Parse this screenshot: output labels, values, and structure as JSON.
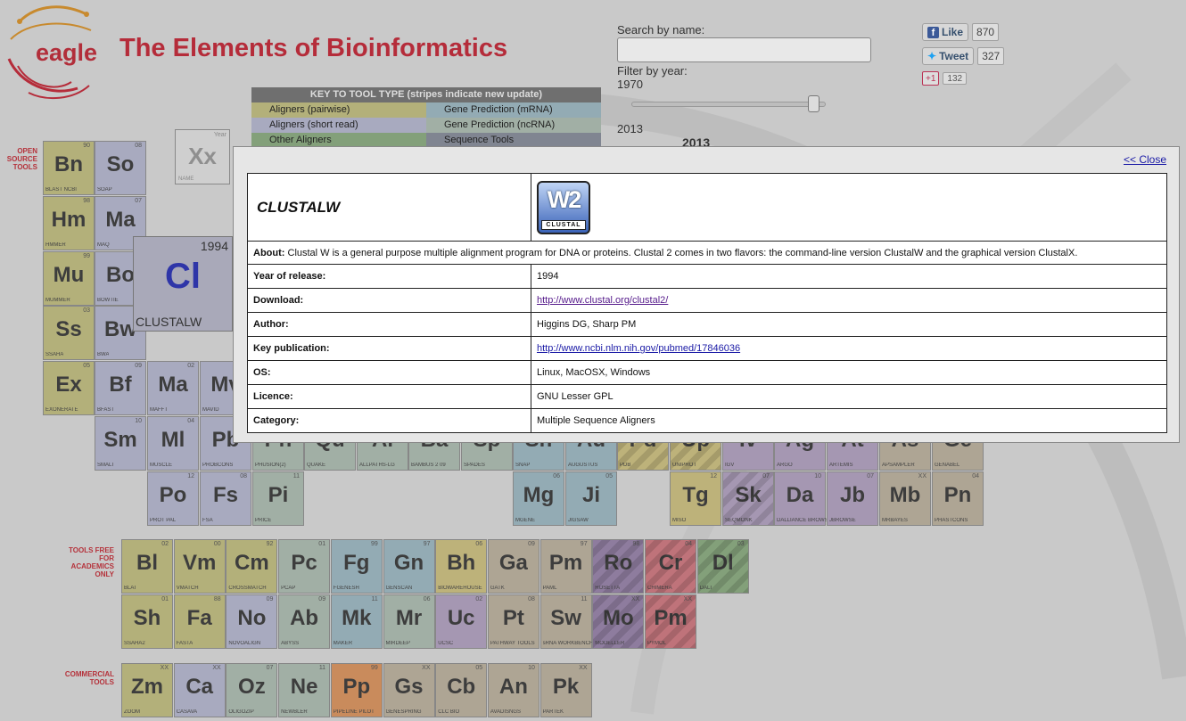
{
  "header": {
    "title": "The Elements of Bioinformatics",
    "logo_text": "eagle"
  },
  "search": {
    "label": "Search by name:",
    "value": "",
    "placeholder": ""
  },
  "filter": {
    "label": "Filter by year:",
    "min_year": "1970",
    "max_year": "2013",
    "slider_position": 0.96,
    "current_year": "2013"
  },
  "social": {
    "like_label": "Like",
    "like_count": "870",
    "tweet_label": "Tweet",
    "tweet_count": "327",
    "plusone_label": "+1",
    "plusone_count": "132"
  },
  "key": {
    "title": "KEY TO TOOL TYPE (stripes indicate new update)",
    "items": [
      {
        "label": "Aligners (pairwise)",
        "color": "#b3b07a"
      },
      {
        "label": "Gene Prediction (mRNA)",
        "color": "#93abb4"
      },
      {
        "label": "Aligners (short read)",
        "color": "#a8aabf"
      },
      {
        "label": "Gene Prediction (ncRNA)",
        "color": "#a1afa5"
      },
      {
        "label": "Other Aligners",
        "color": "#83a07a"
      },
      {
        "label": "Sequence Tools",
        "color": "#808591"
      }
    ]
  },
  "sections": {
    "open_source": "OPEN SOURCE TOOLS",
    "academic": "TOOLS FREE FOR ACADEMICS ONLY",
    "commercial": "COMMERCIAL TOOLS"
  },
  "example_tile": {
    "symbol": "Xx",
    "year": "Year",
    "name": "NAME"
  },
  "hover_tile": {
    "symbol": "Cl",
    "year": "1994",
    "name": "CLUSTALW"
  },
  "tiles": {
    "open": [
      {
        "sym": "Bn",
        "yr": "90",
        "nm": "BLAST NCBI",
        "c": "olive"
      },
      {
        "sym": "So",
        "yr": "08",
        "nm": "SOAP",
        "c": "lavb"
      },
      {
        "sym": "Hm",
        "yr": "98",
        "nm": "HMMER",
        "c": "olive"
      },
      {
        "sym": "Ma",
        "yr": "07",
        "nm": "MAQ",
        "c": "lavb"
      },
      {
        "sym": "Mu",
        "yr": "99",
        "nm": "MUMMER",
        "c": "olive"
      },
      {
        "sym": "Bo",
        "yr": "",
        "nm": "BOWTIE",
        "c": "lavb"
      },
      {
        "sym": "Ss",
        "yr": "03",
        "nm": "SSAHA",
        "c": "olive"
      },
      {
        "sym": "Bw",
        "yr": "",
        "nm": "BWA",
        "c": "lavb"
      },
      {
        "sym": "Ex",
        "yr": "05",
        "nm": "EXONERATE",
        "c": "olive"
      },
      {
        "sym": "Bf",
        "yr": "09",
        "nm": "BFAST",
        "c": "lavb"
      },
      {
        "sym": "Ma",
        "yr": "02",
        "nm": "MAFFT",
        "c": "lavb"
      },
      {
        "sym": "Mv",
        "yr": "",
        "nm": "MAVID",
        "c": "lavb"
      },
      {
        "sym": "Sm",
        "yr": "10",
        "nm": "SMALT",
        "c": "lavb"
      },
      {
        "sym": "Ml",
        "yr": "04",
        "nm": "MUSCLE",
        "c": "lavb"
      },
      {
        "sym": "Pb",
        "yr": "",
        "nm": "PROBCONS",
        "c": "lavb"
      },
      {
        "sym": "Ph",
        "yr": "",
        "nm": "PHUSION(2)",
        "c": "sage"
      },
      {
        "sym": "Qu",
        "yr": "",
        "nm": "QUAKE",
        "c": "sage"
      },
      {
        "sym": "Al",
        "yr": "",
        "nm": "ALLPATHS-LG",
        "c": "sage"
      },
      {
        "sym": "Ba",
        "yr": "",
        "nm": "BAMBUS 2 09",
        "c": "sage"
      },
      {
        "sym": "Sp",
        "yr": "",
        "nm": "SPADES",
        "c": "sage"
      },
      {
        "sym": "Sn",
        "yr": "",
        "nm": "SNAP",
        "c": "tealb"
      },
      {
        "sym": "Au",
        "yr": "",
        "nm": "AUGUSTUS",
        "c": "tealb"
      },
      {
        "sym": "Pd",
        "yr": "",
        "nm": "PDB",
        "c": "mustard",
        "striped": true
      },
      {
        "sym": "Up",
        "yr": "",
        "nm": "UNIPROT",
        "c": "mustard",
        "striped": true
      },
      {
        "sym": "Iv",
        "yr": "",
        "nm": "IGV",
        "c": "purple"
      },
      {
        "sym": "Ag",
        "yr": "",
        "nm": "ARGO",
        "c": "purple"
      },
      {
        "sym": "At",
        "yr": "",
        "nm": "ARTEMIS",
        "c": "purple"
      },
      {
        "sym": "As",
        "yr": "",
        "nm": "APSAMPLER",
        "c": "tan"
      },
      {
        "sym": "Ge",
        "yr": "",
        "nm": "GENABEL",
        "c": "tan"
      },
      {
        "sym": "Po",
        "yr": "12",
        "nm": "PROT PAL",
        "c": "lavb"
      },
      {
        "sym": "Fs",
        "yr": "08",
        "nm": "FSA",
        "c": "lavb"
      },
      {
        "sym": "Pi",
        "yr": "11",
        "nm": "PRICE",
        "c": "sage"
      },
      {
        "sym": "Mg",
        "yr": "06",
        "nm": "MGENE",
        "c": "tealb"
      },
      {
        "sym": "Ji",
        "yr": "05",
        "nm": "JIGSAW",
        "c": "tealb"
      },
      {
        "sym": "Tg",
        "yr": "12",
        "nm": "MISO",
        "c": "mustard"
      },
      {
        "sym": "Sk",
        "yr": "07",
        "nm": "SEQMONK",
        "c": "purple",
        "striped": true
      },
      {
        "sym": "Da",
        "yr": "10",
        "nm": "DALLIANCE BROWSER",
        "c": "purple"
      },
      {
        "sym": "Jb",
        "yr": "07",
        "nm": "JBROWSE",
        "c": "purple"
      },
      {
        "sym": "Mb",
        "yr": "XX",
        "nm": "MRBAYES",
        "c": "tan"
      },
      {
        "sym": "Pn",
        "yr": "04",
        "nm": "PHASTCONS",
        "c": "tan"
      }
    ],
    "academic": [
      {
        "sym": "Bl",
        "yr": "02",
        "nm": "BLAT",
        "c": "olive"
      },
      {
        "sym": "Vm",
        "yr": "00",
        "nm": "VMATCH",
        "c": "olive"
      },
      {
        "sym": "Cm",
        "yr": "92",
        "nm": "CROSSMATCH",
        "c": "olive"
      },
      {
        "sym": "Pc",
        "yr": "01",
        "nm": "PCAP",
        "c": "sage"
      },
      {
        "sym": "Fg",
        "yr": "99",
        "nm": "FGENESH",
        "c": "tealb"
      },
      {
        "sym": "Gn",
        "yr": "97",
        "nm": "GENSCAN",
        "c": "tealb"
      },
      {
        "sym": "Bh",
        "yr": "06",
        "nm": "BIOWAREHOUSE",
        "c": "mustard"
      },
      {
        "sym": "Ga",
        "yr": "09",
        "nm": "GATK",
        "c": "tan"
      },
      {
        "sym": "Pm",
        "yr": "97",
        "nm": "PAML",
        "c": "tan"
      },
      {
        "sym": "Ro",
        "yr": "98",
        "nm": "ROSETTA",
        "c": "violet",
        "striped": true
      },
      {
        "sym": "Cr",
        "yr": "04",
        "nm": "CHIMERA",
        "c": "red",
        "striped": true
      },
      {
        "sym": "Dl",
        "yr": "03",
        "nm": "DALI",
        "c": "green",
        "striped": true
      },
      {
        "sym": "Sh",
        "yr": "01",
        "nm": "SSAHA2",
        "c": "olive"
      },
      {
        "sym": "Fa",
        "yr": "88",
        "nm": "FASTA",
        "c": "olive"
      },
      {
        "sym": "No",
        "yr": "09",
        "nm": "NOVOALIGN",
        "c": "lavb"
      },
      {
        "sym": "Ab",
        "yr": "09",
        "nm": "ABYSS",
        "c": "sage"
      },
      {
        "sym": "Mk",
        "yr": "11",
        "nm": "MAKER",
        "c": "tealb"
      },
      {
        "sym": "Mr",
        "yr": "06",
        "nm": "MIRDEEP",
        "c": "sage"
      },
      {
        "sym": "Uc",
        "yr": "02",
        "nm": "UCSC",
        "c": "purple"
      },
      {
        "sym": "Pt",
        "yr": "08",
        "nm": "PATHWAY TOOLS",
        "c": "tan"
      },
      {
        "sym": "Sw",
        "yr": "11",
        "nm": "sRNA WORKBENCH UEA",
        "c": "tan"
      },
      {
        "sym": "Mo",
        "yr": "XX",
        "nm": "MODELLER",
        "c": "violet",
        "striped": true
      },
      {
        "sym": "Pm",
        "yr": "XX",
        "nm": "PYMOL",
        "c": "red",
        "striped": true
      }
    ],
    "commercial": [
      {
        "sym": "Zm",
        "yr": "XX",
        "nm": "ZOOM",
        "c": "olive"
      },
      {
        "sym": "Ca",
        "yr": "XX",
        "nm": "CASAVA",
        "c": "lavb"
      },
      {
        "sym": "Oz",
        "yr": "07",
        "nm": "OLIGOZIP",
        "c": "sage"
      },
      {
        "sym": "Ne",
        "yr": "11",
        "nm": "NEWBLER",
        "c": "sage"
      },
      {
        "sym": "Pp",
        "yr": "99",
        "nm": "PIPELINE PILOT",
        "c": "orange"
      },
      {
        "sym": "Gs",
        "yr": "XX",
        "nm": "GENESPRING",
        "c": "tan"
      },
      {
        "sym": "Cb",
        "yr": "05",
        "nm": "CLC BIO",
        "c": "tan"
      },
      {
        "sym": "An",
        "yr": "10",
        "nm": "AVADISNGS",
        "c": "tan"
      },
      {
        "sym": "Pk",
        "yr": "XX",
        "nm": "PARTEK",
        "c": "tan"
      }
    ]
  },
  "modal": {
    "close_label": "<< Close",
    "tool_name": "CLUSTALW",
    "logo_main": "W2",
    "logo_sub": "CLUSTAL",
    "about_label": "About:",
    "about_text": "Clustal W is a general purpose multiple alignment program for DNA or proteins. Clustal 2 comes in two flavors: the command-line version ClustalW and the graphical version ClustalX.",
    "rows": [
      {
        "label": "Year of release:",
        "value": "1994"
      },
      {
        "label": "Download:",
        "value": "http://www.clustal.org/clustal2/",
        "link": true,
        "visited": true
      },
      {
        "label": "Author:",
        "value": "Higgins DG, Sharp PM"
      },
      {
        "label": "Key publication:",
        "value": "http://www.ncbi.nlm.nih.gov/pubmed/17846036",
        "link": true
      },
      {
        "label": "OS:",
        "value": "Linux, MacOSX, Windows"
      },
      {
        "label": "Licence:",
        "value": "GNU Lesser GPL"
      },
      {
        "label": "Category:",
        "value": "Multiple Sequence Aligners"
      }
    ]
  }
}
